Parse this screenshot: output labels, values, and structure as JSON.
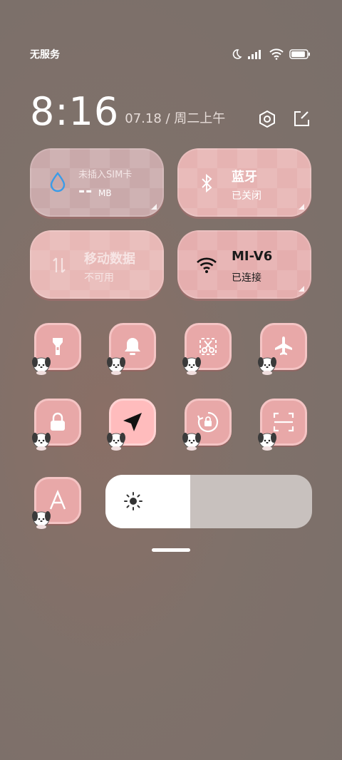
{
  "status": {
    "carrier": "无服务",
    "battery_level": 0.9
  },
  "clock": {
    "time": "8:16",
    "date": "07.18 / 周二上午"
  },
  "tiles": {
    "data": {
      "title": "未插入SIM卡",
      "value": "--",
      "unit": "MB"
    },
    "bluetooth": {
      "title": "蓝牙",
      "status": "已关闭"
    },
    "mobile_data": {
      "title": "移动数据",
      "status": "不可用"
    },
    "wifi": {
      "title": "MI-V6",
      "status": "已连接"
    }
  },
  "toggles": [
    {
      "name": "flashlight",
      "icon": "flashlight-icon",
      "active": false
    },
    {
      "name": "bell",
      "icon": "bell-icon",
      "active": false
    },
    {
      "name": "screenshot",
      "icon": "scissors-icon",
      "active": false
    },
    {
      "name": "airplane",
      "icon": "airplane-icon",
      "active": false
    },
    {
      "name": "lock",
      "icon": "lock-icon",
      "active": false
    },
    {
      "name": "location",
      "icon": "location-arrow-icon",
      "active": true
    },
    {
      "name": "rotation-lock",
      "icon": "rotation-lock-icon",
      "active": false
    },
    {
      "name": "scan",
      "icon": "scan-icon",
      "active": false
    },
    {
      "name": "font",
      "icon": "font-a-icon",
      "active": false
    }
  ],
  "brightness": {
    "level": 0.41
  },
  "colors": {
    "tile_pink": "#e6b3b2",
    "toggle_pink": "#e8a8a8",
    "accent_blue": "#3a9be8"
  }
}
